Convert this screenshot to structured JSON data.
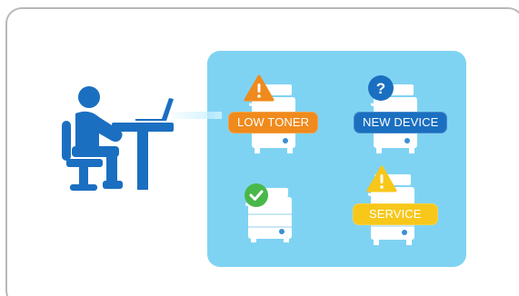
{
  "statuses": {
    "low_toner": {
      "label": "LOW TONER",
      "color": "#f08a1c"
    },
    "new_device": {
      "label": "NEW DEVICE",
      "color": "#1a6fc0"
    },
    "service": {
      "label": "SERVICE",
      "color": "#f7c71a"
    },
    "ok": {
      "color": "#49b84a"
    }
  },
  "colors": {
    "person": "#1b6fc1",
    "panel": "#7fd3f2",
    "printer_body": "#ffffff",
    "printer_accent": "#3a8ed6"
  },
  "icons": [
    "person-at-desk-icon",
    "laptop-icon",
    "printer-icon",
    "warning-icon",
    "question-icon",
    "check-icon"
  ]
}
